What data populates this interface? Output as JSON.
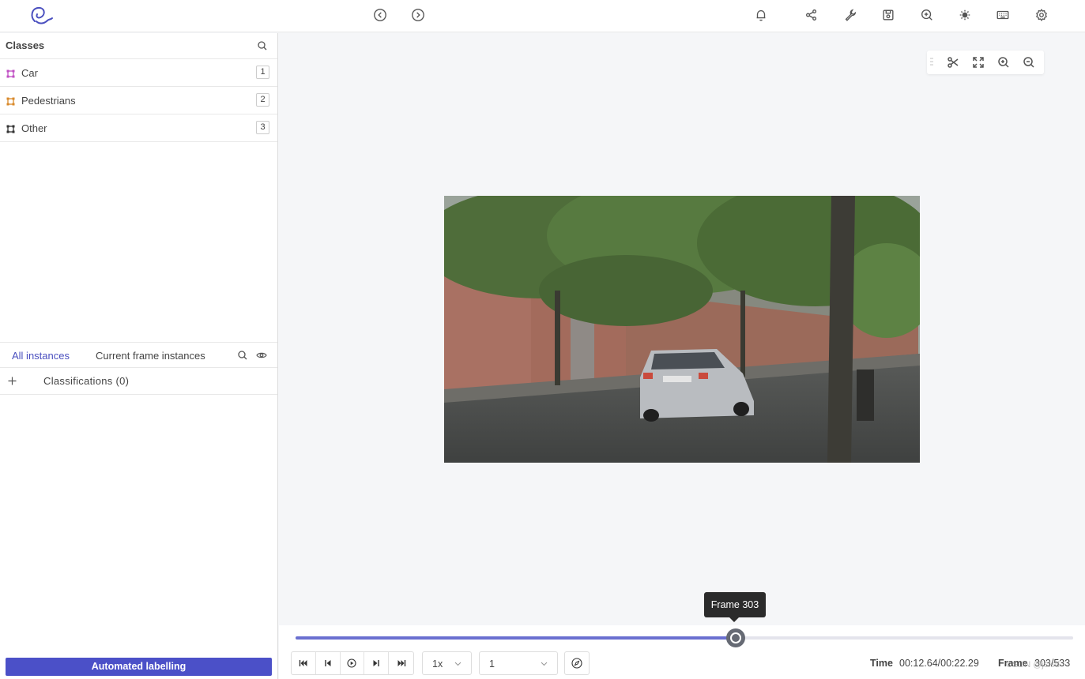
{
  "topbar": {
    "logo_icon": "cvat-logo",
    "nav_icons": [
      "arrow-left-circle-icon",
      "arrow-right-circle-icon"
    ],
    "right_icons": [
      "bell-icon",
      "share-icon",
      "wrench-icon",
      "save-icon",
      "zoom-in-icon",
      "sun-icon",
      "keyboard-icon",
      "gear-icon"
    ]
  },
  "sidebar": {
    "classes_title": "Classes",
    "classes": [
      {
        "label": "Car",
        "key": "1",
        "color": "#c04fc4"
      },
      {
        "label": "Pedestrians",
        "key": "2",
        "color": "#d98a2b"
      },
      {
        "label": "Other",
        "key": "3",
        "color": "#333333"
      }
    ],
    "tabs": {
      "all": "All instances",
      "current": "Current frame instances"
    },
    "classifications_label": "Classifications (0)",
    "auto_button": "Automated labelling"
  },
  "canvas": {
    "tools": [
      "scissors-icon",
      "fit-screen-icon",
      "zoom-in-icon",
      "zoom-out-icon"
    ]
  },
  "player": {
    "frame_tooltip": "Frame 303",
    "progress": 0.566,
    "speed": "1x",
    "step": "1",
    "time_label": "Time",
    "time_value": "00:12.64/00:22.29",
    "frame_label": "Frame",
    "frame_value": "303/533",
    "watermark": "CSDN @jsfsd"
  },
  "colors": {
    "accent": "#4b50c8",
    "slider_fill": "#6a6fd0"
  }
}
